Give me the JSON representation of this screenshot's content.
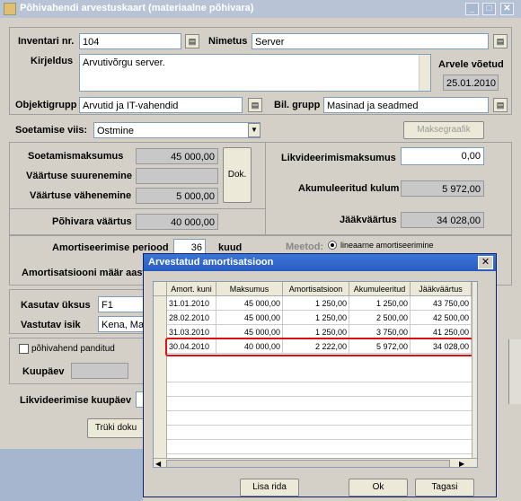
{
  "window": {
    "title": "Põhivahendi arvestuskaart (materiaalne põhivara)"
  },
  "form": {
    "inventar_label": "Inventari nr.",
    "inventar_value": "104",
    "nimetus_label": "Nimetus",
    "nimetus_value": "Server",
    "kirjeldus_label": "Kirjeldus",
    "kirjeldus_value": "Arvutivõrgu server.",
    "arvele_label": "Arvele võetud",
    "arvele_value": "25.01.2010",
    "objektigrupp_label": "Objektigrupp",
    "objektigrupp_value": "Arvutid ja IT-vahendid",
    "bilgrupp_label": "Bil. grupp",
    "bilgrupp_value": "Masinad ja seadmed",
    "soetamise_label": "Soetamise viis:",
    "soetamise_value": "Ostmine",
    "maksegraafik": "Maksegraafik",
    "soetamismaksumus_label": "Soetamismaksumus",
    "soetamismaksumus_value": "45 000,00",
    "suurenemine_label": "Väärtuse suurenemine",
    "suurenemine_value": "",
    "vahenemine_label": "Väärtuse vähenemine",
    "vahenemine_value": "5 000,00",
    "dok": "Dok.",
    "pohivara_label": "Põhivara väärtus",
    "pohivara_value": "40 000,00",
    "likvid_label": "Likvideerimismaksumus",
    "likvid_value": "0,00",
    "kulum_label": "Akumuleeritud kulum",
    "kulum_value": "5 972,00",
    "jaak_label": "Jääkväärtus",
    "jaak_value": "34 028,00",
    "periood_label": "Amortiseerimise periood",
    "periood_value": "36",
    "kuud": "kuud",
    "meetod_label": "Meetod:",
    "meetod_value": "lineaarne amortiseerimine",
    "maar_label": "Amortisatsiooni määr aast",
    "kasutav_label": "Kasutav üksus",
    "kasutav_value": "F1",
    "vastutav_label": "Vastutav isik",
    "vastutav_value": "Kena, Mat",
    "panditud_label": "põhivahend panditud",
    "kuupaev_label": "Kuupäev",
    "likvkuup_label": "Likvideerimise kuupäev",
    "trukk": "Trüki doku"
  },
  "popup": {
    "title": "Arvestatud amortisatsioon",
    "columns": [
      "Amort. kuni",
      "Maksumus",
      "Amortisatsioon",
      "Akumuleeritud",
      "Jääkväärtus"
    ],
    "rows": [
      [
        "31.01.2010",
        "45 000,00",
        "1 250,00",
        "1 250,00",
        "43 750,00"
      ],
      [
        "28.02.2010",
        "45 000,00",
        "1 250,00",
        "2 500,00",
        "42 500,00"
      ],
      [
        "31.03.2010",
        "45 000,00",
        "1 250,00",
        "3 750,00",
        "41 250,00"
      ],
      [
        "30.04.2010",
        "40 000,00",
        "2 222,00",
        "5 972,00",
        "34 028,00"
      ]
    ],
    "lisa_rida": "Lisa rida",
    "ok": "Ok",
    "tagasi": "Tagasi"
  }
}
